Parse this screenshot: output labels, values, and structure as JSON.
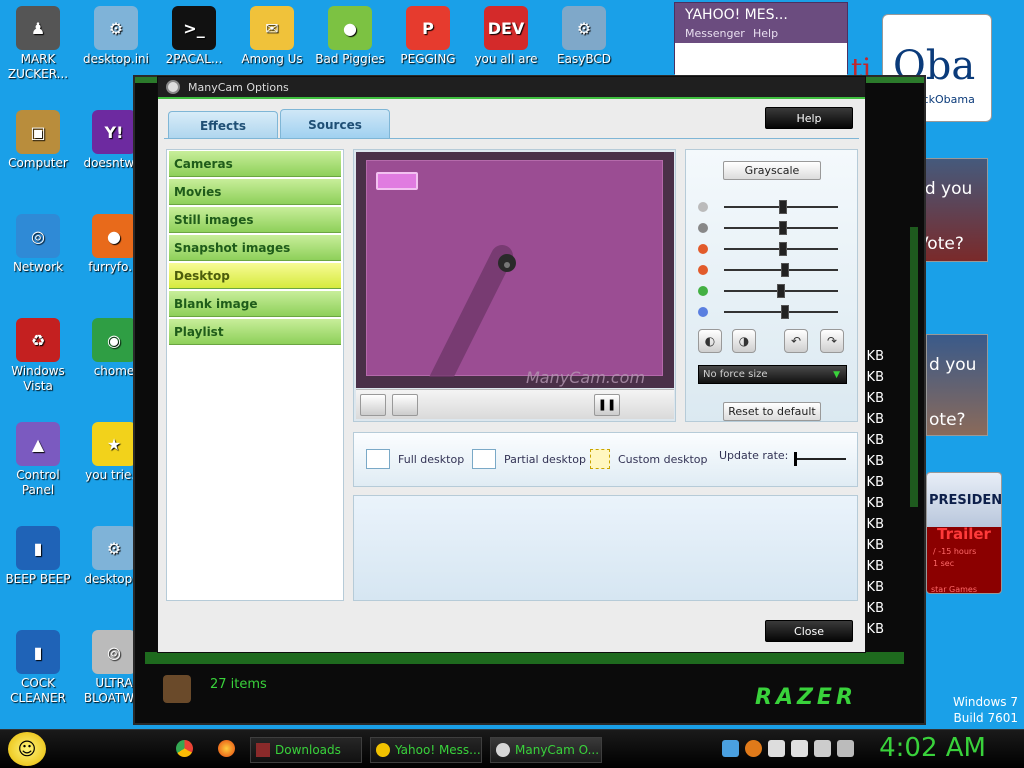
{
  "desktop_icons": [
    {
      "id": "mark",
      "label": "MARK ZUCKER...",
      "color": "#555555",
      "glyph": "♟"
    },
    {
      "id": "desktop-ini-1",
      "label": "desktop.ini",
      "color": "#7fb3d8",
      "glyph": "⚙"
    },
    {
      "id": "2pacal",
      "label": "2PACAL...",
      "color": "#111111",
      "glyph": ">_"
    },
    {
      "id": "among-us",
      "label": "Among Us",
      "color": "#f0c23a",
      "glyph": "✉"
    },
    {
      "id": "bad-piggies",
      "label": "Bad Piggies",
      "color": "#7cc242",
      "glyph": "●"
    },
    {
      "id": "pegging",
      "label": "PEGGING",
      "color": "#e63b2e",
      "glyph": "P"
    },
    {
      "id": "you-all-are",
      "label": "you all are",
      "color": "#d42a2a",
      "glyph": "DEV"
    },
    {
      "id": "easybcd",
      "label": "EasyBCD",
      "color": "#7fa8c9",
      "glyph": "⚙"
    },
    {
      "id": "computer",
      "label": "Computer",
      "color": "#b98d3c",
      "glyph": "▣"
    },
    {
      "id": "doesntw",
      "label": "doesntw...",
      "color": "#6d2aa0",
      "glyph": "Y!"
    },
    {
      "id": "network",
      "label": "Network",
      "color": "#2f8ad6",
      "glyph": "◎"
    },
    {
      "id": "furryfo",
      "label": "furryfo...",
      "color": "#e86a1b",
      "glyph": "●"
    },
    {
      "id": "windows-vista",
      "label": "Windows Vista",
      "color": "#c42020",
      "glyph": "♻"
    },
    {
      "id": "chome",
      "label": "chome",
      "color": "#2f9e44",
      "glyph": "◉"
    },
    {
      "id": "control-panel",
      "label": "Control Panel",
      "color": "#7b5ac0",
      "glyph": "▲"
    },
    {
      "id": "you-trie",
      "label": "you trie...",
      "color": "#f2d21b",
      "glyph": "★"
    },
    {
      "id": "beep-beep",
      "label": "BEEP BEEP",
      "color": "#1f63b7",
      "glyph": "▮"
    },
    {
      "id": "desktop-ini-2",
      "label": "desktop...",
      "color": "#7fb3d8",
      "glyph": "⚙"
    },
    {
      "id": "cock-cleaner",
      "label": "COCK CLEANER",
      "color": "#1f63b7",
      "glyph": "▮"
    },
    {
      "id": "ultra-bloat",
      "label": "ULTRA BLOATW...",
      "color": "#bbbbbb",
      "glyph": "◎"
    }
  ],
  "yahoo": {
    "title": "YAHOO! MES...",
    "menu": [
      "Messenger",
      "Help"
    ]
  },
  "ads": {
    "obama_text": "Oba",
    "obama_sub": "BarackObama",
    "did_you": "Did you",
    "vote": "Vote?",
    "hillary_text": "d you",
    "hillary_vote": "ote?",
    "president": "PRESIDENT",
    "trailer": "Trailer",
    "hours": "/ -15 hours",
    "sec": "1 sec",
    "games": "star Games",
    "partial": "ti"
  },
  "razer": {
    "items_count": "27 items",
    "logo": "RAZER",
    "kb_labels": [
      "KB",
      "KB",
      "KB",
      "KB",
      "KB",
      "KB",
      "KB",
      "KB",
      "KB",
      "KB",
      "KB",
      "KB",
      "KB",
      "KB"
    ]
  },
  "manycam": {
    "title": "ManyCam Options",
    "tabs": [
      {
        "label": "Effects",
        "active": false
      },
      {
        "label": "Sources",
        "active": true
      }
    ],
    "help_label": "Help",
    "close_label": "Close",
    "sources": [
      {
        "label": "Cameras",
        "selected": false
      },
      {
        "label": "Movies",
        "selected": false
      },
      {
        "label": "Still images",
        "selected": false
      },
      {
        "label": "Snapshot images",
        "selected": false
      },
      {
        "label": "Desktop",
        "selected": true
      },
      {
        "label": "Blank image",
        "selected": false
      },
      {
        "label": "Playlist",
        "selected": false
      }
    ],
    "preview_watermark": "ManyCam.com",
    "grayscale_label": "Grayscale",
    "sliders": [
      {
        "name": "brightness",
        "color": "#bbbbbb",
        "value": 0.5
      },
      {
        "name": "contrast",
        "color": "#888888",
        "value": 0.5
      },
      {
        "name": "saturation",
        "color": "#e25b2b",
        "value": 0.5
      },
      {
        "name": "red",
        "color": "#e25b2b",
        "value": 0.52
      },
      {
        "name": "green",
        "color": "#43b043",
        "value": 0.48
      },
      {
        "name": "blue",
        "color": "#5a7fe0",
        "value": 0.52
      }
    ],
    "force_size": "No force size",
    "reset_label": "Reset to default",
    "modes": [
      {
        "label": "Full desktop"
      },
      {
        "label": "Partial desktop"
      },
      {
        "label": "Custom desktop"
      }
    ],
    "update_rate_label": "Update rate:"
  },
  "taskbar": {
    "items": [
      {
        "label": "Downloads"
      },
      {
        "label": "Yahoo! Mess..."
      },
      {
        "label": "ManyCam O..."
      }
    ],
    "clock": "4:02 AM"
  },
  "watermark": {
    "line1": "Windows 7",
    "line2": "Build 7601"
  }
}
